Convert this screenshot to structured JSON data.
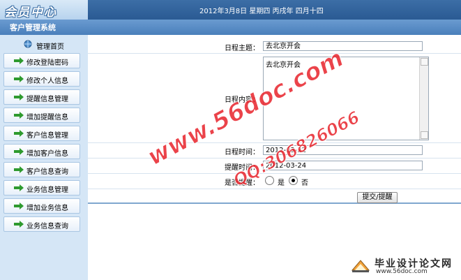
{
  "header": {
    "logo_text": "会员中心",
    "date_text": "2012年3月8日 星期四 丙戌年 四月十四",
    "system_name": "客户管理系统"
  },
  "sidebar": {
    "home_label": "管理首页",
    "items": [
      {
        "label": "修改登陆密码"
      },
      {
        "label": "修改个人信息"
      },
      {
        "label": "提醒信息管理"
      },
      {
        "label": "增加提醒信息"
      },
      {
        "label": "客户信息管理"
      },
      {
        "label": "增加客户信息"
      },
      {
        "label": "客户信息查询"
      },
      {
        "label": "业务信息管理"
      },
      {
        "label": "增加业务信息"
      },
      {
        "label": "业务信息查询"
      }
    ]
  },
  "form": {
    "subject_label": "日程主题：",
    "subject_value": "去北京开会",
    "content_label": "日程内容：",
    "content_value": "去北京开会",
    "time_label": "日程时间：",
    "time_value": "2012-03-22",
    "remind_time_label": "提醒时间：",
    "remind_time_value": "2012-03-24",
    "remind_label": "是否提醒：",
    "option_yes": "是",
    "option_no": "否",
    "selected": "否",
    "submit_label": "提交/提醒"
  },
  "watermark": {
    "site": "www.56doc.com",
    "qq": "QQ:306826066",
    "brand_title": "毕业设计论文网",
    "brand_url": "www.56doc.com"
  },
  "colors": {
    "header_dark": "#2a5a93",
    "header_light": "#6a9bd0",
    "sidebar_bg": "#d5e6f6",
    "menu_arrow": "#2e9a2e",
    "watermark_red": "#e8232b"
  }
}
